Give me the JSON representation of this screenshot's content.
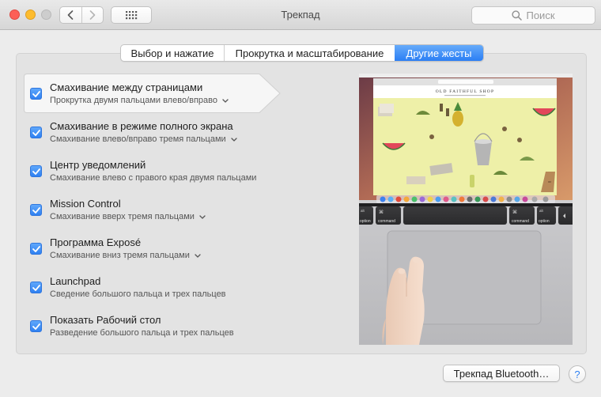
{
  "window": {
    "title": "Трекпад"
  },
  "search": {
    "placeholder": "Поиск"
  },
  "tabs": [
    {
      "label": "Выбор и нажатие",
      "active": false
    },
    {
      "label": "Прокрутка и масштабирование",
      "active": false
    },
    {
      "label": "Другие жесты",
      "active": true
    }
  ],
  "gestures": [
    {
      "title": "Смахивание между страницами",
      "subtitle": "Прокрутка двумя пальцами влево/вправо",
      "checked": true,
      "has_menu": true,
      "selected": true
    },
    {
      "title": "Смахивание в режиме полного экрана",
      "subtitle": "Смахивание влево/вправо тремя пальцами",
      "checked": true,
      "has_menu": true,
      "selected": false
    },
    {
      "title": "Центр уведомлений",
      "subtitle": "Смахивание влево с правого края двумя пальцами",
      "checked": true,
      "has_menu": false,
      "selected": false
    },
    {
      "title": "Mission Control",
      "subtitle": "Смахивание вверх тремя пальцами",
      "checked": true,
      "has_menu": true,
      "selected": false
    },
    {
      "title": "Программа Exposé",
      "subtitle": "Смахивание вниз тремя пальцами",
      "checked": true,
      "has_menu": true,
      "selected": false
    },
    {
      "title": "Launchpad",
      "subtitle": "Сведение большого пальца и трех пальцев",
      "checked": true,
      "has_menu": false,
      "selected": false
    },
    {
      "title": "Показать Рабочий стол",
      "subtitle": "Разведение большого пальца и трех пальцев",
      "checked": true,
      "has_menu": false,
      "selected": false
    }
  ],
  "preview": {
    "shop_name": "OLD FAITHFUL SHOP",
    "keys": {
      "left_option": "option",
      "left_command": "command",
      "right_command": "command",
      "right_option": "option",
      "alt_symbol": "alt",
      "cmd_symbol": "⌘"
    }
  },
  "footer": {
    "bluetooth_button": "Трекпад Bluetooth…",
    "help_label": "?"
  },
  "colors": {
    "accent": "#2f80f1",
    "window_bg": "#ececec",
    "panel_bg": "#e3e3e3",
    "close": "#fc5f57",
    "minimize": "#fdbc2e",
    "preview_screen_bg": "#eef0a8"
  }
}
